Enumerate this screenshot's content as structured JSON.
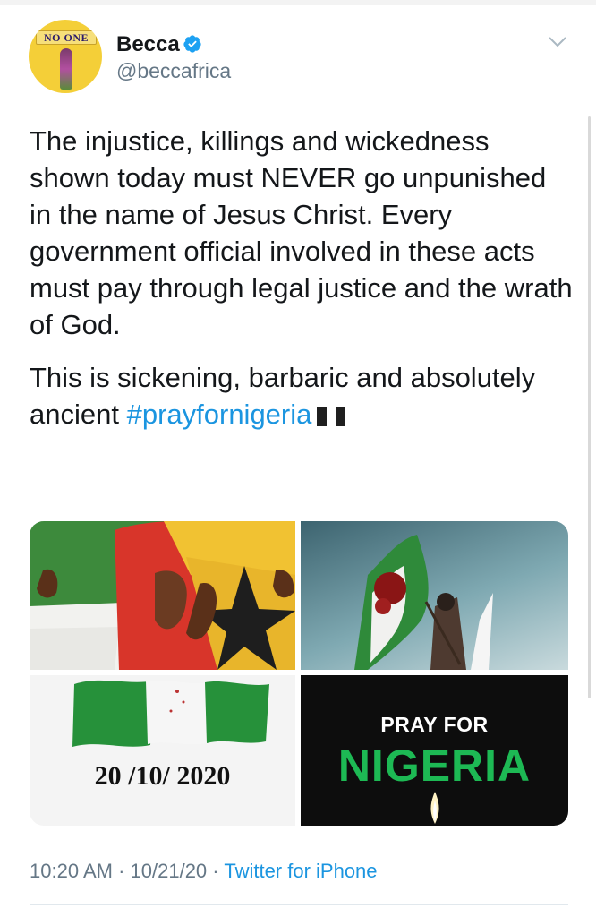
{
  "tweet": {
    "avatar_logo_text": "NO ONE",
    "display_name": "Becca",
    "verified": true,
    "handle": "@beccafrica",
    "paragraphs": [
      "The injustice, killings and wickedness shown today must NEVER go unpunished in the name of Jesus Christ. Every government official involved in these acts must pay through legal justice and the wrath of God.",
      "This is sickening, barbaric and absolutely ancient"
    ],
    "hashtag": "#prayfornigeria",
    "flag_emoji": "nigeria-flag",
    "media": {
      "images": [
        {
          "name": "ghana-nigeria-flags-embrace"
        },
        {
          "name": "bloodied-nigeria-flag-protester"
        },
        {
          "name": "nigeria-flag-date",
          "caption": "20 /10/ 2020"
        },
        {
          "name": "pray-for-nigeria-candle",
          "line1": "PRAY FOR",
          "line2": "NIGERIA"
        }
      ]
    },
    "time": "10:20 AM",
    "date": "10/21/20",
    "separator": "·",
    "source": "Twitter for iPhone"
  },
  "colors": {
    "link_blue": "#1b95e0",
    "text": "#14171a",
    "secondary": "#657786",
    "nigeria_green": "#008751",
    "nigeria_text_green": "#1db954"
  }
}
